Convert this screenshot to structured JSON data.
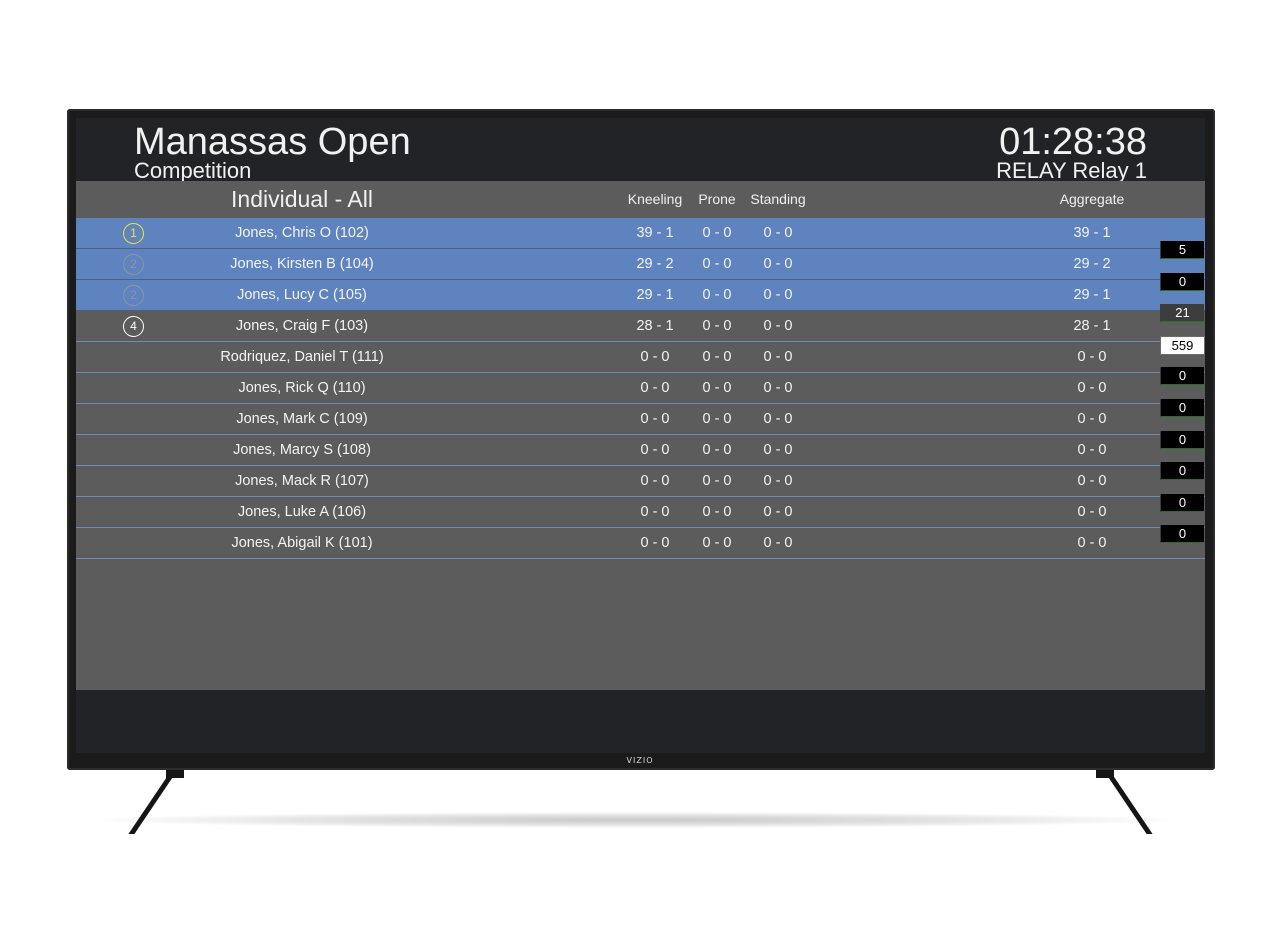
{
  "brand": "VIZIO",
  "header": {
    "title": "Manassas Open",
    "subtitle": "Competition",
    "clock": "01:28:38",
    "relay": "RELAY Relay 1"
  },
  "columns": {
    "group": "Individual - All",
    "kneeling": "Kneeling",
    "prone": "Prone",
    "standing": "Standing",
    "aggregate": "Aggregate"
  },
  "rows": [
    {
      "rank": "1",
      "name": "Jones, Chris O (102)",
      "kneeling": "39 - 1",
      "prone": "0 - 0",
      "standing": "0 - 0",
      "aggregate": "39 - 1",
      "highlighted": true
    },
    {
      "rank": "2",
      "name": "Jones, Kirsten B (104)",
      "kneeling": "29 - 2",
      "prone": "0 - 0",
      "standing": "0 - 0",
      "aggregate": "29 - 2",
      "highlighted": true
    },
    {
      "rank": "2",
      "name": "Jones, Lucy C (105)",
      "kneeling": "29 - 1",
      "prone": "0 - 0",
      "standing": "0 - 0",
      "aggregate": "29 - 1",
      "highlighted": true
    },
    {
      "rank": "4",
      "name": "Jones, Craig F (103)",
      "kneeling": "28 - 1",
      "prone": "0 - 0",
      "standing": "0 - 0",
      "aggregate": "28 - 1",
      "highlighted": false
    },
    {
      "rank": "",
      "name": "Rodriquez, Daniel T (111)",
      "kneeling": "0 - 0",
      "prone": "0 - 0",
      "standing": "0 - 0",
      "aggregate": "0 - 0",
      "highlighted": false
    },
    {
      "rank": "",
      "name": "Jones, Rick Q (110)",
      "kneeling": "0 - 0",
      "prone": "0 - 0",
      "standing": "0 - 0",
      "aggregate": "0 - 0",
      "highlighted": false
    },
    {
      "rank": "",
      "name": "Jones, Mark C (109)",
      "kneeling": "0 - 0",
      "prone": "0 - 0",
      "standing": "0 - 0",
      "aggregate": "0 - 0",
      "highlighted": false
    },
    {
      "rank": "",
      "name": "Jones, Marcy S (108)",
      "kneeling": "0 - 0",
      "prone": "0 - 0",
      "standing": "0 - 0",
      "aggregate": "0 - 0",
      "highlighted": false
    },
    {
      "rank": "",
      "name": "Jones, Mack R (107)",
      "kneeling": "0 - 0",
      "prone": "0 - 0",
      "standing": "0 - 0",
      "aggregate": "0 - 0",
      "highlighted": false
    },
    {
      "rank": "",
      "name": "Jones, Luke A (106)",
      "kneeling": "0 - 0",
      "prone": "0 - 0",
      "standing": "0 - 0",
      "aggregate": "0 - 0",
      "highlighted": false
    },
    {
      "rank": "",
      "name": "Jones, Abigail K (101)",
      "kneeling": "0 - 0",
      "prone": "0 - 0",
      "standing": "0 - 0",
      "aggregate": "0 - 0",
      "highlighted": false
    }
  ],
  "side_values": [
    {
      "value": "5",
      "style": "black"
    },
    {
      "value": "0",
      "style": "black"
    },
    {
      "value": "21",
      "style": "gray"
    },
    {
      "value": "559",
      "style": "white"
    },
    {
      "value": "0",
      "style": "black"
    },
    {
      "value": "0",
      "style": "black"
    },
    {
      "value": "0",
      "style": "black"
    },
    {
      "value": "0",
      "style": "black"
    },
    {
      "value": "0",
      "style": "black"
    },
    {
      "value": "0",
      "style": "black"
    }
  ],
  "colors": {
    "highlight_row": "#5f83bf",
    "board_bg": "#5c5c5c",
    "header_bg": "#222326",
    "gold_rank": "#e9e43a"
  }
}
